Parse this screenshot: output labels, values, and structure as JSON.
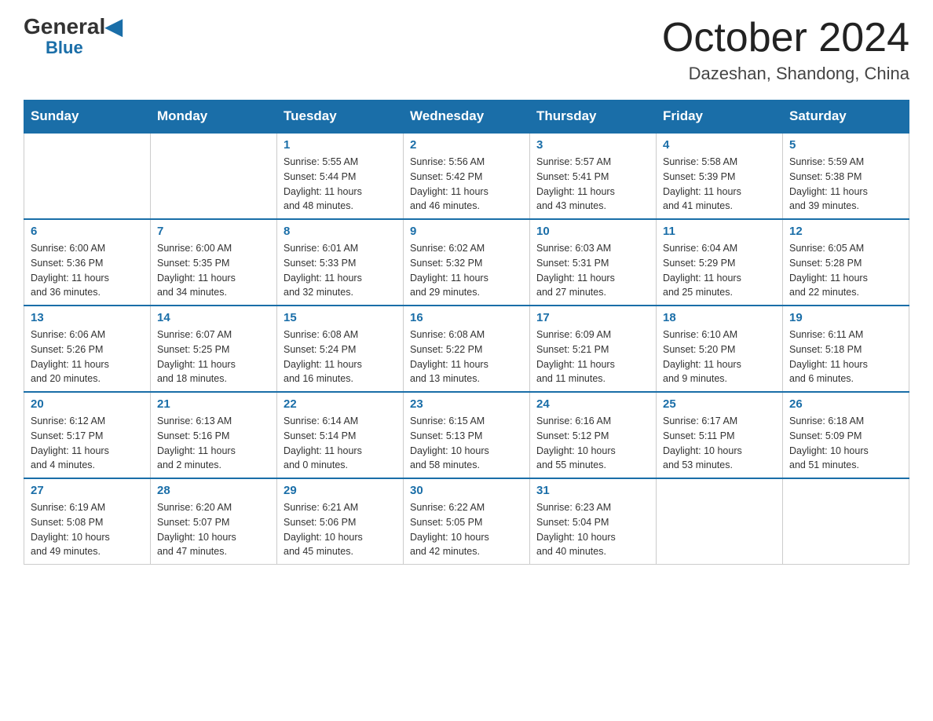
{
  "header": {
    "logo_general": "General",
    "logo_blue": "Blue",
    "month_title": "October 2024",
    "location": "Dazeshan, Shandong, China"
  },
  "days_of_week": [
    "Sunday",
    "Monday",
    "Tuesday",
    "Wednesday",
    "Thursday",
    "Friday",
    "Saturday"
  ],
  "weeks": [
    [
      {
        "day": "",
        "info": ""
      },
      {
        "day": "",
        "info": ""
      },
      {
        "day": "1",
        "info": "Sunrise: 5:55 AM\nSunset: 5:44 PM\nDaylight: 11 hours\nand 48 minutes."
      },
      {
        "day": "2",
        "info": "Sunrise: 5:56 AM\nSunset: 5:42 PM\nDaylight: 11 hours\nand 46 minutes."
      },
      {
        "day": "3",
        "info": "Sunrise: 5:57 AM\nSunset: 5:41 PM\nDaylight: 11 hours\nand 43 minutes."
      },
      {
        "day": "4",
        "info": "Sunrise: 5:58 AM\nSunset: 5:39 PM\nDaylight: 11 hours\nand 41 minutes."
      },
      {
        "day": "5",
        "info": "Sunrise: 5:59 AM\nSunset: 5:38 PM\nDaylight: 11 hours\nand 39 minutes."
      }
    ],
    [
      {
        "day": "6",
        "info": "Sunrise: 6:00 AM\nSunset: 5:36 PM\nDaylight: 11 hours\nand 36 minutes."
      },
      {
        "day": "7",
        "info": "Sunrise: 6:00 AM\nSunset: 5:35 PM\nDaylight: 11 hours\nand 34 minutes."
      },
      {
        "day": "8",
        "info": "Sunrise: 6:01 AM\nSunset: 5:33 PM\nDaylight: 11 hours\nand 32 minutes."
      },
      {
        "day": "9",
        "info": "Sunrise: 6:02 AM\nSunset: 5:32 PM\nDaylight: 11 hours\nand 29 minutes."
      },
      {
        "day": "10",
        "info": "Sunrise: 6:03 AM\nSunset: 5:31 PM\nDaylight: 11 hours\nand 27 minutes."
      },
      {
        "day": "11",
        "info": "Sunrise: 6:04 AM\nSunset: 5:29 PM\nDaylight: 11 hours\nand 25 minutes."
      },
      {
        "day": "12",
        "info": "Sunrise: 6:05 AM\nSunset: 5:28 PM\nDaylight: 11 hours\nand 22 minutes."
      }
    ],
    [
      {
        "day": "13",
        "info": "Sunrise: 6:06 AM\nSunset: 5:26 PM\nDaylight: 11 hours\nand 20 minutes."
      },
      {
        "day": "14",
        "info": "Sunrise: 6:07 AM\nSunset: 5:25 PM\nDaylight: 11 hours\nand 18 minutes."
      },
      {
        "day": "15",
        "info": "Sunrise: 6:08 AM\nSunset: 5:24 PM\nDaylight: 11 hours\nand 16 minutes."
      },
      {
        "day": "16",
        "info": "Sunrise: 6:08 AM\nSunset: 5:22 PM\nDaylight: 11 hours\nand 13 minutes."
      },
      {
        "day": "17",
        "info": "Sunrise: 6:09 AM\nSunset: 5:21 PM\nDaylight: 11 hours\nand 11 minutes."
      },
      {
        "day": "18",
        "info": "Sunrise: 6:10 AM\nSunset: 5:20 PM\nDaylight: 11 hours\nand 9 minutes."
      },
      {
        "day": "19",
        "info": "Sunrise: 6:11 AM\nSunset: 5:18 PM\nDaylight: 11 hours\nand 6 minutes."
      }
    ],
    [
      {
        "day": "20",
        "info": "Sunrise: 6:12 AM\nSunset: 5:17 PM\nDaylight: 11 hours\nand 4 minutes."
      },
      {
        "day": "21",
        "info": "Sunrise: 6:13 AM\nSunset: 5:16 PM\nDaylight: 11 hours\nand 2 minutes."
      },
      {
        "day": "22",
        "info": "Sunrise: 6:14 AM\nSunset: 5:14 PM\nDaylight: 11 hours\nand 0 minutes."
      },
      {
        "day": "23",
        "info": "Sunrise: 6:15 AM\nSunset: 5:13 PM\nDaylight: 10 hours\nand 58 minutes."
      },
      {
        "day": "24",
        "info": "Sunrise: 6:16 AM\nSunset: 5:12 PM\nDaylight: 10 hours\nand 55 minutes."
      },
      {
        "day": "25",
        "info": "Sunrise: 6:17 AM\nSunset: 5:11 PM\nDaylight: 10 hours\nand 53 minutes."
      },
      {
        "day": "26",
        "info": "Sunrise: 6:18 AM\nSunset: 5:09 PM\nDaylight: 10 hours\nand 51 minutes."
      }
    ],
    [
      {
        "day": "27",
        "info": "Sunrise: 6:19 AM\nSunset: 5:08 PM\nDaylight: 10 hours\nand 49 minutes."
      },
      {
        "day": "28",
        "info": "Sunrise: 6:20 AM\nSunset: 5:07 PM\nDaylight: 10 hours\nand 47 minutes."
      },
      {
        "day": "29",
        "info": "Sunrise: 6:21 AM\nSunset: 5:06 PM\nDaylight: 10 hours\nand 45 minutes."
      },
      {
        "day": "30",
        "info": "Sunrise: 6:22 AM\nSunset: 5:05 PM\nDaylight: 10 hours\nand 42 minutes."
      },
      {
        "day": "31",
        "info": "Sunrise: 6:23 AM\nSunset: 5:04 PM\nDaylight: 10 hours\nand 40 minutes."
      },
      {
        "day": "",
        "info": ""
      },
      {
        "day": "",
        "info": ""
      }
    ]
  ]
}
